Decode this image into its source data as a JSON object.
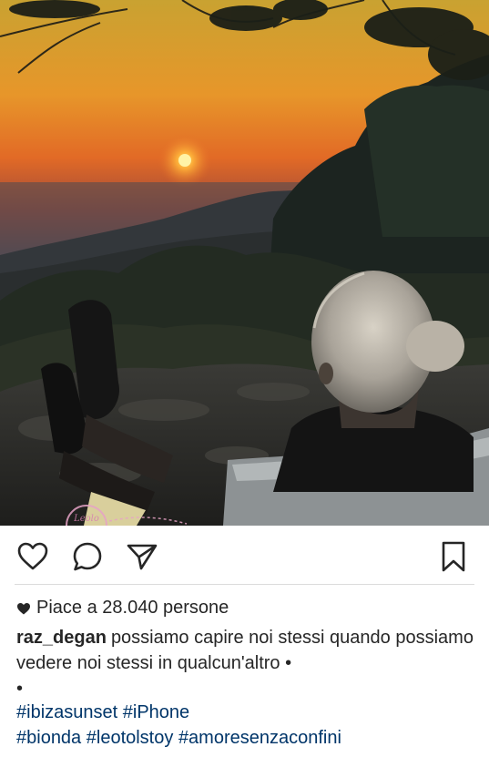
{
  "post": {
    "likes_text": "Piace a 28.040 persone",
    "username": "raz_degan",
    "caption_text": "possiamo capire noi stessi quando possiamo vedere noi stessi in qualcun'altro •",
    "caption_bullet": "•",
    "hashtags_line1": [
      "#ibizasunset",
      "#iPhone"
    ],
    "hashtags_line2": [
      "#bionda",
      "#leotolstoy",
      "#amoresenzaconfini"
    ]
  },
  "icons": {
    "like": "heart-outline-icon",
    "comment": "speech-bubble-icon",
    "share": "paper-plane-icon",
    "save": "bookmark-icon",
    "likes_prefix": "heart-filled-icon"
  },
  "colors": {
    "text": "#262626",
    "hashtag": "#003569",
    "divider": "#dbdbdb",
    "icon": "#262626"
  },
  "watermark": {
    "text": "Leolo Lieve"
  }
}
